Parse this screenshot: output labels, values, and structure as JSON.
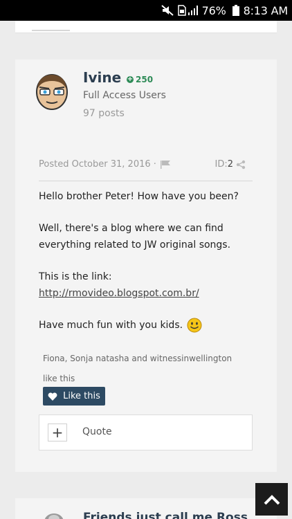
{
  "status_bar": {
    "battery_percent": "76%",
    "time": "8:13 AM"
  },
  "post": {
    "author": {
      "name": "Ivine",
      "reputation": "250",
      "group": "Full Access Users",
      "posts": "97 posts"
    },
    "meta": {
      "posted": "Posted October 31, 2016 ·",
      "id_label": "ID:",
      "id_value": "2"
    },
    "body": {
      "p1": "Hello brother Peter! How have you been?",
      "p2": "Well, there's a blog where we can find everything related to JW original songs.",
      "p3_prefix": "This is the link: ",
      "p3_link": "http://rmovideo.blogspot.com.br/",
      "p4": "Have much fun with you kids."
    },
    "likes_text": "Fiona, Sonja natasha and witnessinwellington like this",
    "like_button_label": "Like this",
    "quote_label": "Quote"
  },
  "next_post": {
    "title": "Friends just call me Ross"
  },
  "icons": {
    "status": [
      "mute-icon",
      "sim-icon",
      "signal-icon",
      "battery-icon"
    ],
    "post": [
      "avatar",
      "reputation-plus-icon",
      "flag-icon",
      "share-icon",
      "smiley-icon",
      "heart-icon",
      "plus-icon"
    ],
    "page": [
      "scroll-top-icon"
    ]
  },
  "colors": {
    "like_button": "#2d4a63",
    "reputation": "#2e8b57",
    "author_name": "#2c3e50"
  }
}
